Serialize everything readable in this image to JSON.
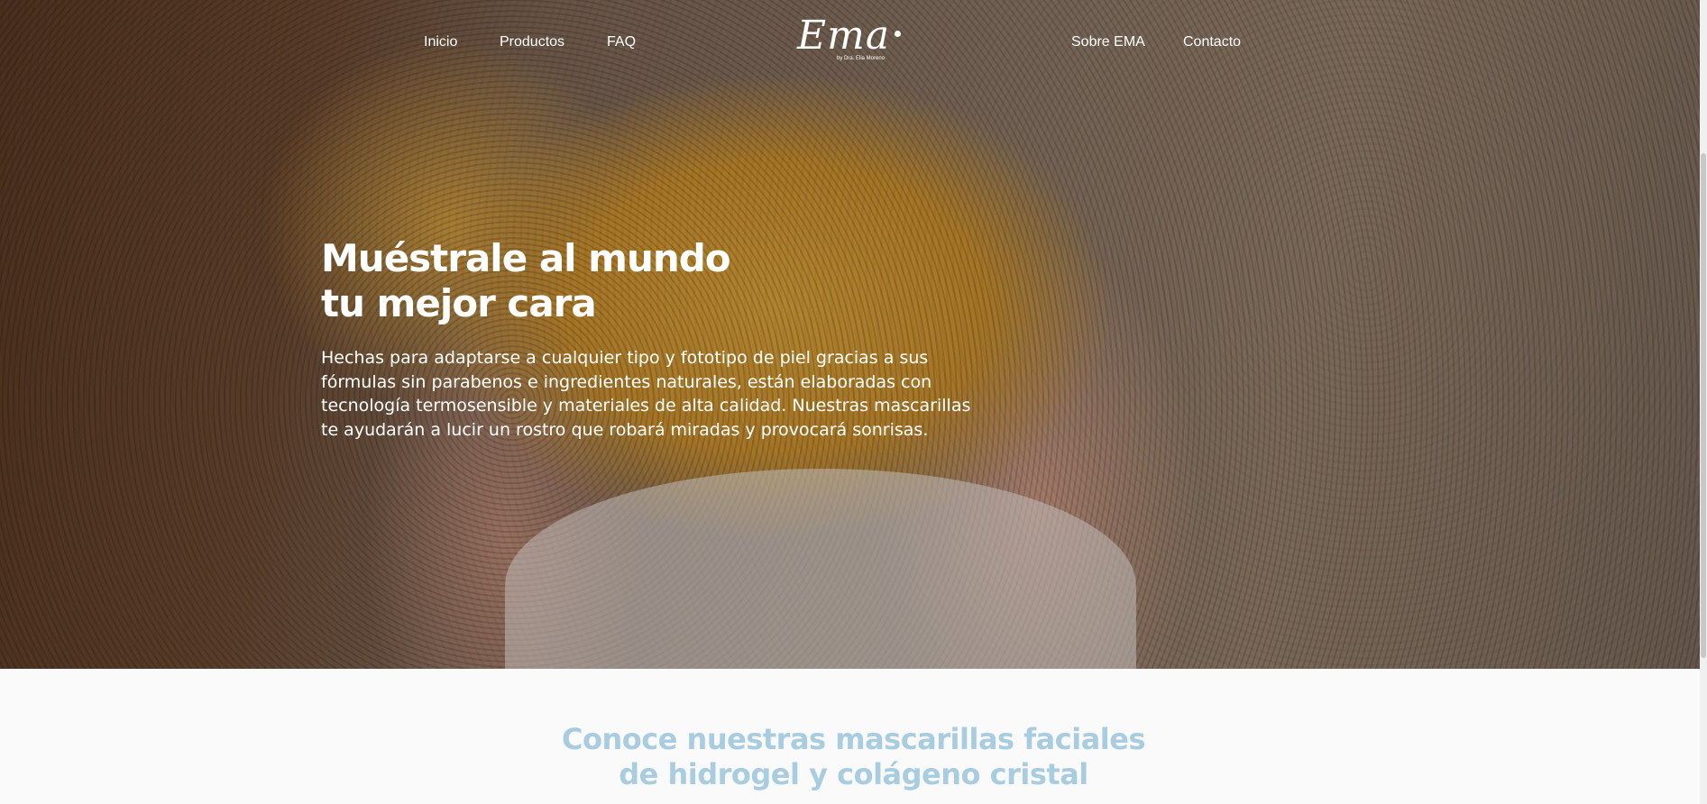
{
  "nav": {
    "items": [
      {
        "label": "Inicio"
      },
      {
        "label": "Productos"
      },
      {
        "label": "FAQ"
      },
      {
        "label": "Sobre EMA"
      },
      {
        "label": "Contacto"
      }
    ]
  },
  "logo": {
    "word": "Ema",
    "sub": "by Dra. Elia Moreno"
  },
  "hero": {
    "title_line1": "Muéstrale al mundo",
    "title_line2": "tu mejor cara",
    "text": "Hechas para adaptarse a cualquier tipo y fototipo de piel gracias a sus fórmulas sin parabenos e ingredientes naturales, están elaboradas con tecnología termosensible y materiales de alta calidad. Nuestras mascarillas te ayudarán a lucir un rostro que robará miradas y provocará sonrisas."
  },
  "section": {
    "title_line1": "Conoce nuestras mascarillas faciales",
    "title_line2": "de hidrogel y colágeno cristal"
  },
  "colors": {
    "accent_title": "#a9cde0",
    "nav_text": "#ffffff",
    "page_bg": "#fafafa"
  }
}
